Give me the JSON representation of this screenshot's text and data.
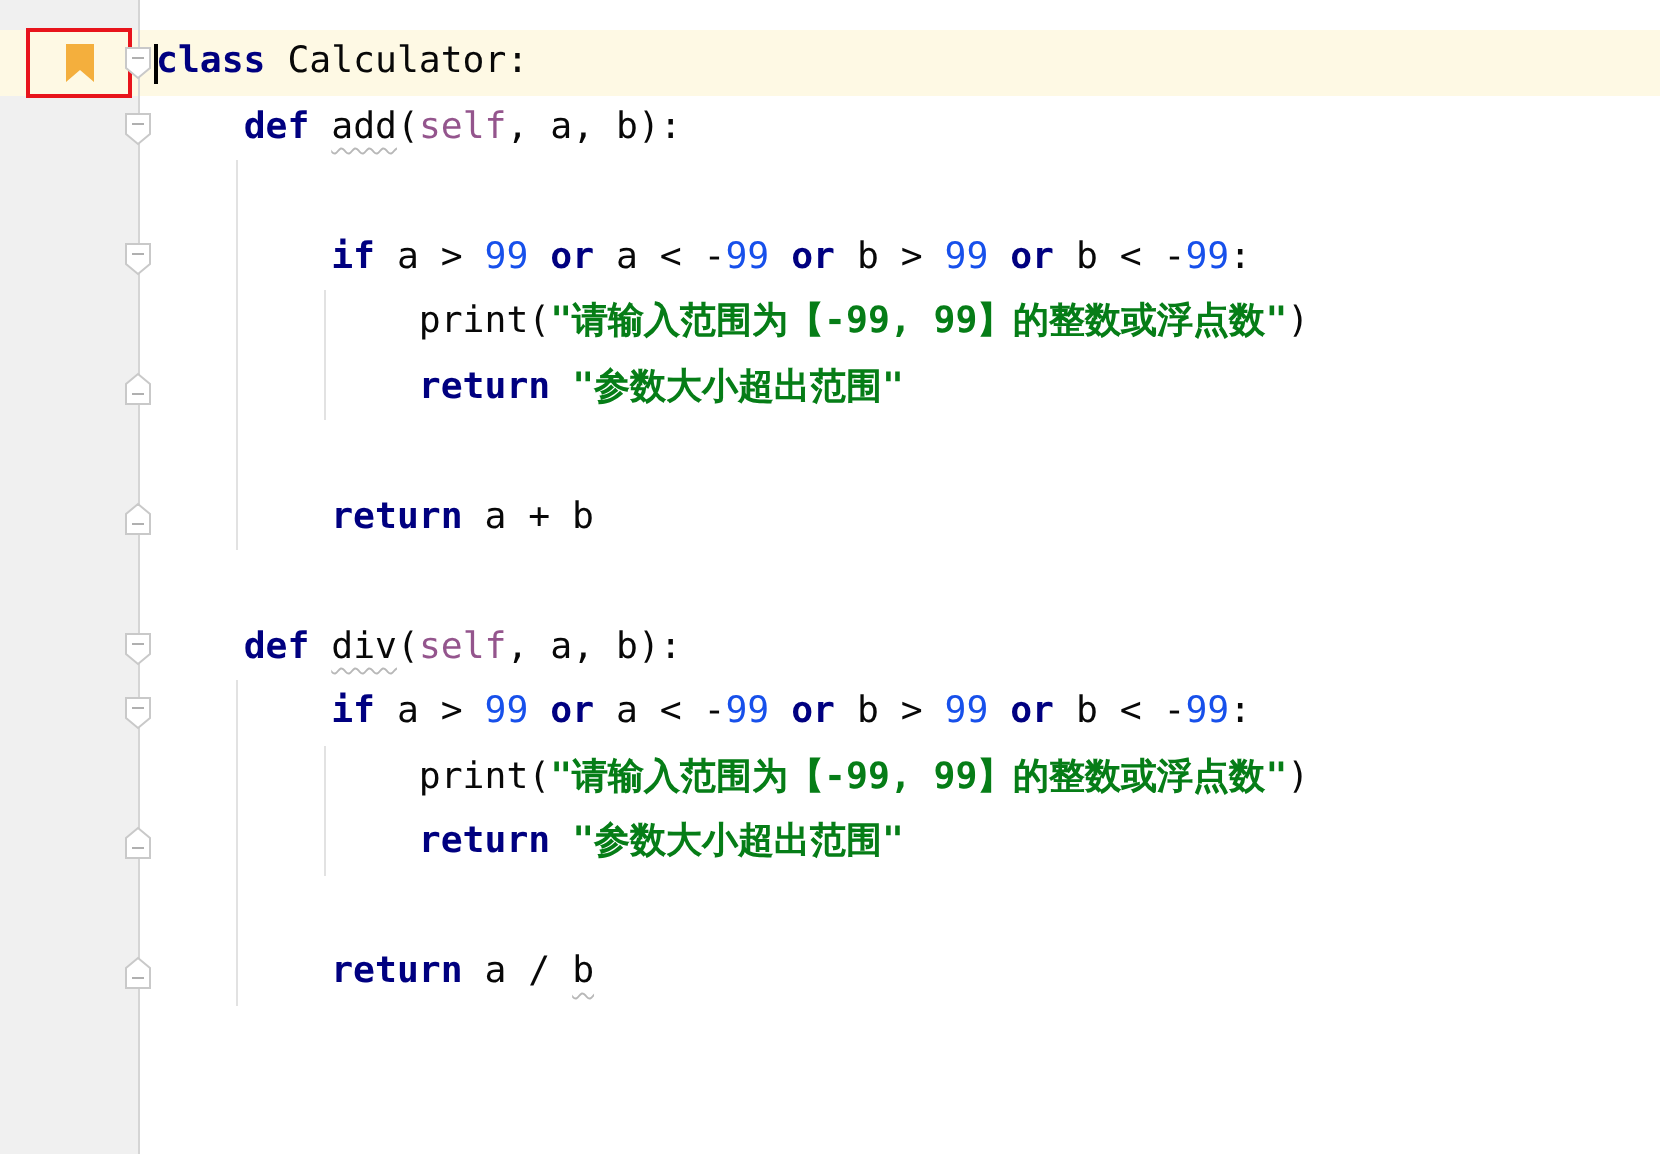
{
  "editor": {
    "lines": [
      {
        "current": true,
        "bookmark": true,
        "framed": true,
        "fold_start": true,
        "tokens": [
          {
            "kind": "keyword",
            "t": "class"
          },
          {
            "kind": "plain",
            "t": " Calculator:"
          }
        ]
      },
      {
        "fold_start": true,
        "tokens": [
          {
            "kind": "keyword",
            "t": "    def "
          },
          {
            "kind": "plain",
            "t": "add",
            "warning": true
          },
          {
            "kind": "plain",
            "t": "("
          },
          {
            "kind": "self",
            "t": "self"
          },
          {
            "kind": "plain",
            "t": ", a, b):"
          }
        ]
      },
      {
        "kind": "blank"
      },
      {
        "fold_start": true,
        "tokens": [
          {
            "kind": "keyword",
            "t": "        if"
          },
          {
            "kind": "plain",
            "t": " a > "
          },
          {
            "kind": "number",
            "t": "99"
          },
          {
            "kind": "keyword",
            "t": " or"
          },
          {
            "kind": "plain",
            "t": " a < -"
          },
          {
            "kind": "number",
            "t": "99"
          },
          {
            "kind": "keyword",
            "t": " or"
          },
          {
            "kind": "plain",
            "t": " b > "
          },
          {
            "kind": "number",
            "t": "99"
          },
          {
            "kind": "keyword",
            "t": " or"
          },
          {
            "kind": "plain",
            "t": " b < -"
          },
          {
            "kind": "number",
            "t": "99"
          },
          {
            "kind": "plain",
            "t": ":"
          }
        ]
      },
      {
        "tokens": [
          {
            "kind": "plain",
            "t": "            print("
          },
          {
            "kind": "string",
            "t": "\"请输入范围为【-99, 99】的整数或浮点数\""
          },
          {
            "kind": "plain",
            "t": ")"
          }
        ]
      },
      {
        "fold_end": true,
        "tokens": [
          {
            "kind": "keyword",
            "t": "            return "
          },
          {
            "kind": "string",
            "t": "\"参数大小超出范围\""
          }
        ]
      },
      {
        "kind": "blank"
      },
      {
        "fold_end": true,
        "tokens": [
          {
            "kind": "keyword",
            "t": "        return"
          },
          {
            "kind": "plain",
            "t": " a + b"
          }
        ]
      },
      {
        "kind": "blank"
      },
      {
        "fold_start": true,
        "tokens": [
          {
            "kind": "keyword",
            "t": "    def "
          },
          {
            "kind": "plain",
            "t": "div",
            "warning": true
          },
          {
            "kind": "plain",
            "t": "("
          },
          {
            "kind": "self",
            "t": "self"
          },
          {
            "kind": "plain",
            "t": ", a, b):"
          }
        ]
      },
      {
        "fold_start": true,
        "tokens": [
          {
            "kind": "keyword",
            "t": "        if"
          },
          {
            "kind": "plain",
            "t": " a > "
          },
          {
            "kind": "number",
            "t": "99"
          },
          {
            "kind": "keyword",
            "t": " or"
          },
          {
            "kind": "plain",
            "t": " a < -"
          },
          {
            "kind": "number",
            "t": "99"
          },
          {
            "kind": "keyword",
            "t": " or"
          },
          {
            "kind": "plain",
            "t": " b > "
          },
          {
            "kind": "number",
            "t": "99"
          },
          {
            "kind": "keyword",
            "t": " or"
          },
          {
            "kind": "plain",
            "t": " b < -"
          },
          {
            "kind": "number",
            "t": "99"
          },
          {
            "kind": "plain",
            "t": ":"
          }
        ]
      },
      {
        "tokens": [
          {
            "kind": "plain",
            "t": "            print("
          },
          {
            "kind": "string",
            "t": "\"请输入范围为【-99, 99】的整数或浮点数\""
          },
          {
            "kind": "plain",
            "t": ")"
          }
        ]
      },
      {
        "fold_end": true,
        "tokens": [
          {
            "kind": "keyword",
            "t": "            return "
          },
          {
            "kind": "string",
            "t": "\"参数大小超出范围\""
          }
        ]
      },
      {
        "kind": "blank"
      },
      {
        "fold_end": true,
        "tokens": [
          {
            "kind": "keyword",
            "t": "        return"
          },
          {
            "kind": "plain",
            "t": " a / "
          },
          {
            "kind": "plain",
            "t": "b",
            "warning": true
          }
        ]
      }
    ]
  }
}
